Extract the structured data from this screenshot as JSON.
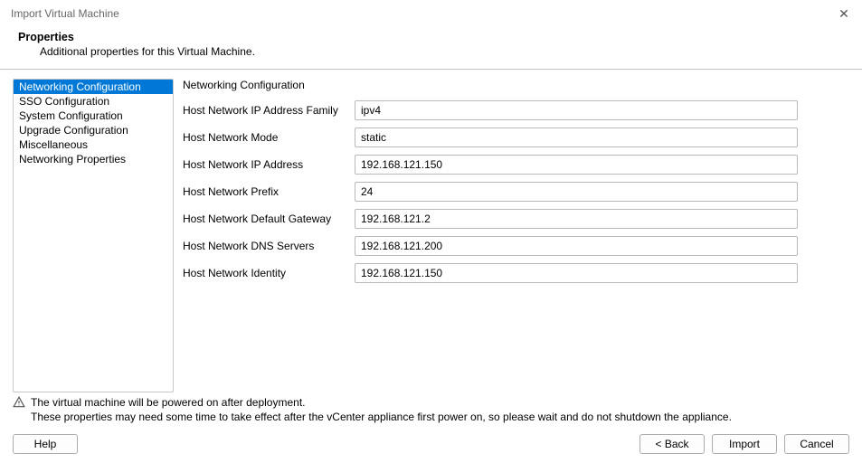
{
  "window": {
    "title": "Import Virtual Machine"
  },
  "header": {
    "title": "Properties",
    "subtitle": "Additional properties for this Virtual Machine."
  },
  "sidebar": {
    "items": [
      {
        "label": "Networking Configuration",
        "selected": true
      },
      {
        "label": "SSO Configuration",
        "selected": false
      },
      {
        "label": "System Configuration",
        "selected": false
      },
      {
        "label": "Upgrade Configuration",
        "selected": false
      },
      {
        "label": "Miscellaneous",
        "selected": false
      },
      {
        "label": "Networking Properties",
        "selected": false
      }
    ]
  },
  "section": {
    "title": "Networking Configuration",
    "fields": [
      {
        "label": "Host Network IP Address Family",
        "value": "ipv4"
      },
      {
        "label": "Host Network Mode",
        "value": "static"
      },
      {
        "label": "Host Network IP Address",
        "value": "192.168.121.150"
      },
      {
        "label": "Host Network Prefix",
        "value": "24"
      },
      {
        "label": "Host Network Default Gateway",
        "value": "192.168.121.2"
      },
      {
        "label": "Host Network DNS Servers",
        "value": "192.168.121.200"
      },
      {
        "label": "Host Network Identity",
        "value": "192.168.121.150"
      }
    ]
  },
  "notes": {
    "line1": "The virtual machine will be powered on after deployment.",
    "line2": "These properties may need some time to take effect after the vCenter appliance first power on, so please wait and do not shutdown the appliance."
  },
  "footer": {
    "help": "Help",
    "back": "< Back",
    "import": "Import",
    "cancel": "Cancel"
  }
}
